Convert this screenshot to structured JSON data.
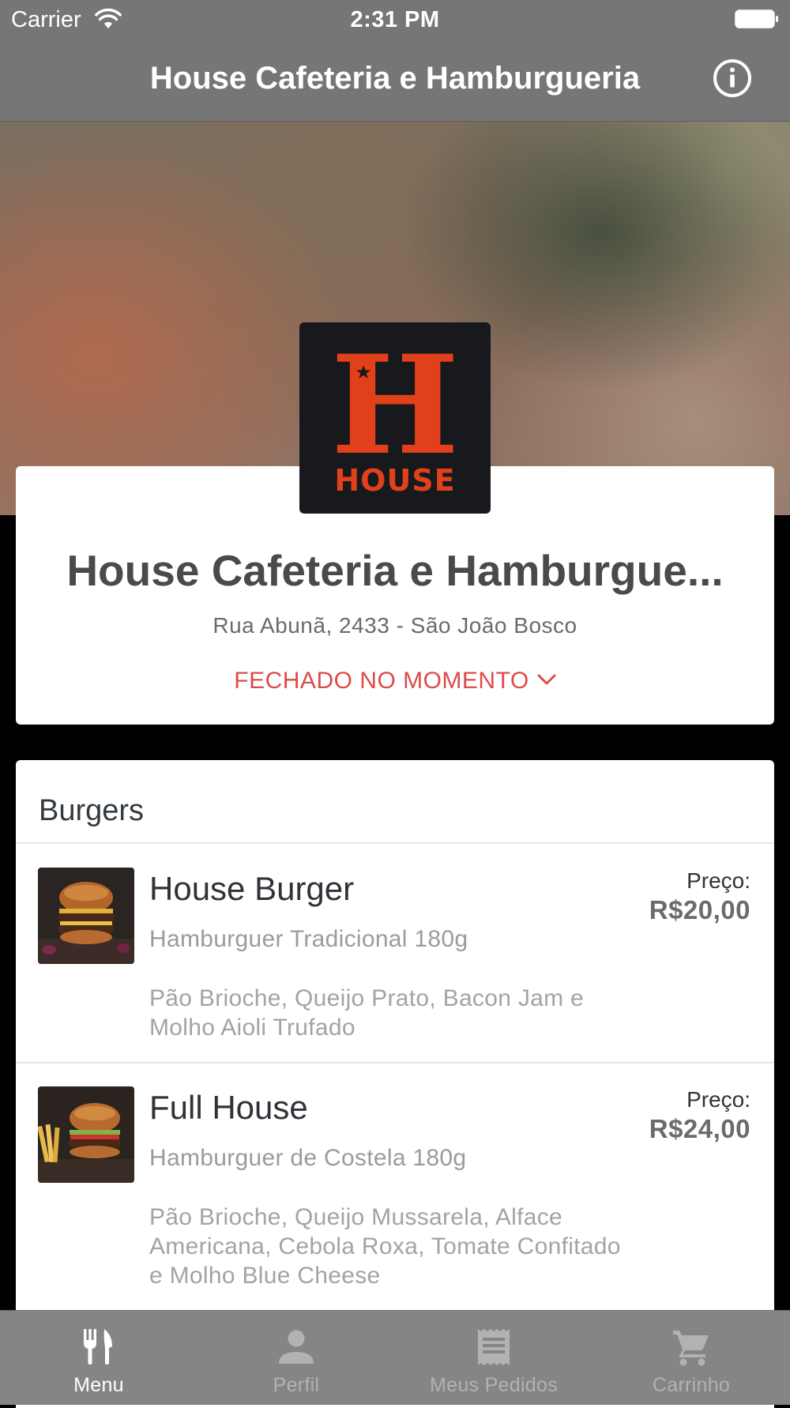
{
  "status_bar": {
    "carrier": "Carrier",
    "time": "2:31 PM"
  },
  "nav": {
    "title": "House Cafeteria e Hamburgueria",
    "info_icon": "info-icon"
  },
  "logo": {
    "letter": "H",
    "wordmark": "HOUSE",
    "colors": {
      "background": "#17191c",
      "brand_red": "#e2401a"
    }
  },
  "restaurant": {
    "name": "House Cafeteria e Hamburgue...",
    "address": "Rua Abunã, 2433 - São João Bosco",
    "status": "FECHADO NO MOMENTO",
    "status_color": "#dd4b4b"
  },
  "menu": {
    "section_title": "Burgers",
    "items": [
      {
        "name": "House Burger",
        "subtitle": "Hamburguer Tradicional 180g",
        "description": "Pão Brioche, Queijo Prato, Bacon Jam e Molho Aioli Trufado",
        "price_label": "Preço:",
        "price": "R$20,00"
      },
      {
        "name": "Full House",
        "subtitle": "Hamburguer de Costela 180g",
        "description": "Pão Brioche, Queijo Mussarela, Alface Americana, Cebola Roxa, Tomate Confitado e Molho Blue Cheese",
        "price_label": "Preço:",
        "price": "R$24,00"
      }
    ]
  },
  "tabbar": {
    "tabs": [
      {
        "label": "Menu",
        "icon": "fork-knife-icon",
        "active": true
      },
      {
        "label": "Perfil",
        "icon": "person-icon",
        "active": false
      },
      {
        "label": "Meus Pedidos",
        "icon": "receipt-icon",
        "active": false
      },
      {
        "label": "Carrinho",
        "icon": "cart-icon",
        "active": false
      }
    ]
  }
}
